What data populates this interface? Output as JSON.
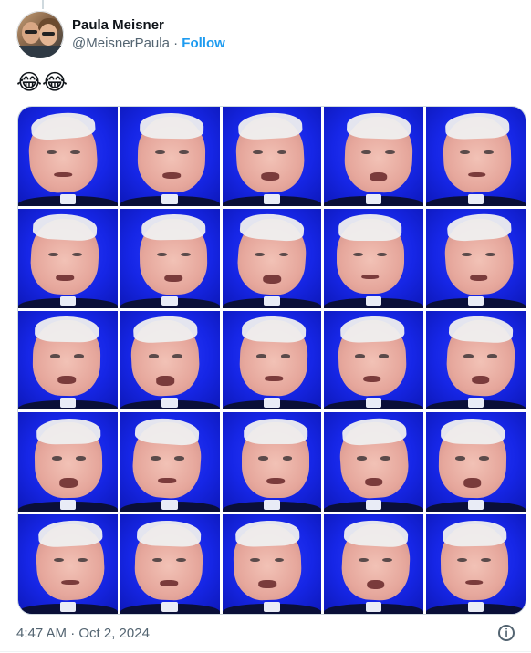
{
  "tweet": {
    "author": {
      "display_name": "Paula Meisner",
      "handle": "@MeisnerPaula",
      "separator": " · ",
      "follow_label": "Follow"
    },
    "text": "😂😂",
    "media": {
      "rows": 5,
      "columns": 5,
      "tile_count": 25
    },
    "timestamp": "4:47 AM · Oct 2, 2024",
    "icons": {
      "info": "info-icon"
    },
    "colors": {
      "accent": "#1d9bf0",
      "secondary_text": "#536471",
      "background_blue": "#1626e6"
    }
  }
}
